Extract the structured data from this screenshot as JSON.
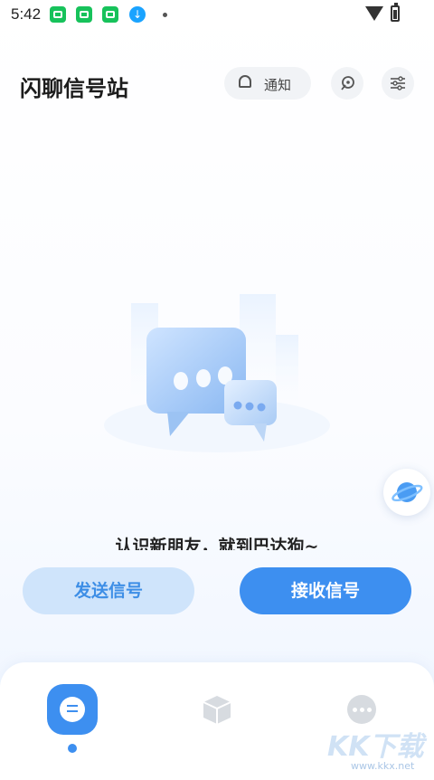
{
  "status_bar": {
    "time": "5:42",
    "download_icon": "↓"
  },
  "header": {
    "title": "闪聊信号站",
    "notify_label": "通知"
  },
  "main": {
    "slogan": "认识新朋友，就到巴达狗~"
  },
  "actions": {
    "send_label": "发送信号",
    "receive_label": "接收信号"
  },
  "watermark": {
    "text": "KK下载",
    "url": "www.kkx.net"
  },
  "colors": {
    "accent": "#3d8ff0",
    "accent_light": "#cfe4fb",
    "title": "#1c1c1c"
  }
}
